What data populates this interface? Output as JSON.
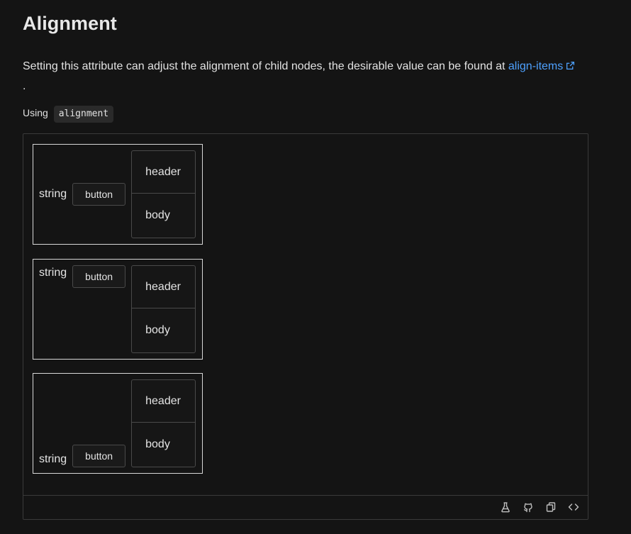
{
  "heading": {
    "title": "Alignment"
  },
  "description": {
    "text": "Setting this attribute can adjust the alignment of child nodes, the desirable value can be found at ",
    "link_text": "align-items",
    "suffix": "."
  },
  "usage": {
    "label": "Using",
    "code": "alignment"
  },
  "examples": [
    {
      "alignment": "center",
      "string_text": "string",
      "button_label": "button",
      "card_header": "header",
      "card_body": "body"
    },
    {
      "alignment": "start",
      "string_text": "string",
      "button_label": "button",
      "card_header": "header",
      "card_body": "body"
    },
    {
      "alignment": "end",
      "string_text": "string",
      "button_label": "button",
      "card_header": "header",
      "card_body": "body"
    }
  ],
  "footer": {
    "icons": [
      "flask-icon",
      "github-icon",
      "copy-icon",
      "code-icon"
    ]
  },
  "colors": {
    "background": "#141414",
    "link": "#4ea1ff",
    "border": "#3a3a3a"
  }
}
